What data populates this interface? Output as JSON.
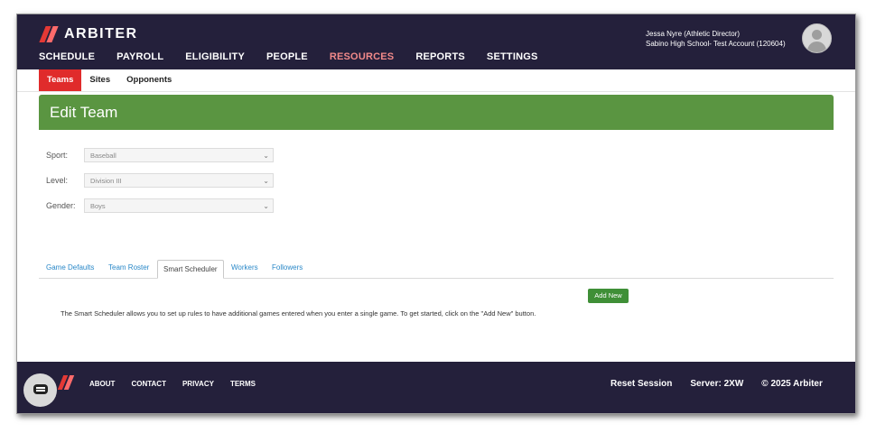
{
  "app": {
    "logo_text": "ARBITER"
  },
  "nav": {
    "items": [
      "SCHEDULE",
      "PAYROLL",
      "ELIGIBILITY",
      "PEOPLE",
      "RESOURCES",
      "REPORTS",
      "SETTINGS"
    ],
    "active": "RESOURCES"
  },
  "user": {
    "name": "Jessa Nyre (Athletic Director)",
    "account": "Sabino High School- Test Account (120604)"
  },
  "subnav": {
    "items": [
      "Teams",
      "Sites",
      "Opponents"
    ],
    "active": "Teams"
  },
  "page": {
    "title": "Edit Team"
  },
  "form": {
    "sport": {
      "label": "Sport:",
      "value": "Baseball"
    },
    "level": {
      "label": "Level:",
      "value": "Division III"
    },
    "gender": {
      "label": "Gender:",
      "value": "Boys"
    }
  },
  "tabs": {
    "items": [
      "Game Defaults",
      "Team Roster",
      "Smart Scheduler",
      "Workers",
      "Followers"
    ],
    "active": "Smart Scheduler"
  },
  "smart_scheduler": {
    "add_new_label": "Add New",
    "info": "The Smart Scheduler allows you to set up rules to have additional games entered when you enter a single game. To get started, click on the \"Add New\" button."
  },
  "footer": {
    "links": [
      "ABOUT",
      "CONTACT",
      "PRIVACY",
      "TERMS"
    ],
    "reset_session": "Reset Session",
    "server": "Server: 2XW",
    "copyright": "© 2025 Arbiter"
  },
  "colors": {
    "topbar": "#24203b",
    "accent_red": "#e02b2b",
    "header_green": "#5a9541",
    "button_green": "#3f8f37",
    "link_blue": "#2a88c8"
  }
}
